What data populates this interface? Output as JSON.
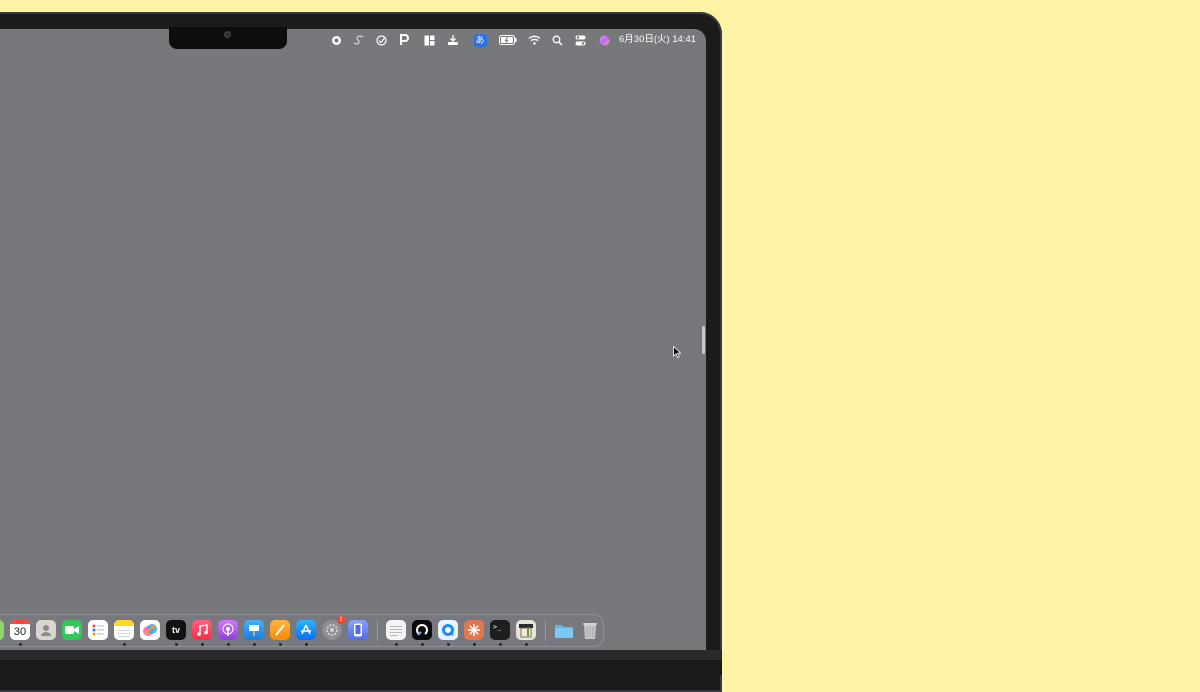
{
  "menubar": {
    "input_method": "あ",
    "datetime": "6月30日(火)  14:41",
    "status_icons": [
      "record-icon",
      "s-icon",
      "checkmark-icon",
      "p-icon",
      "layout-icon",
      "download-icon",
      "input-method-icon",
      "battery-icon",
      "wifi-icon",
      "search-icon",
      "control-center-icon",
      "siri-icon"
    ]
  },
  "dock": {
    "calendar_day": "30",
    "tv_label": "tv",
    "terminal_prompt": ">_",
    "system_settings_badge": "1",
    "icons": [
      "partial-icon",
      "calendar-icon",
      "contacts-icon",
      "facetime-icon",
      "reminders-icon",
      "notes-icon",
      "freeform-icon",
      "apple-tv-icon",
      "music-icon",
      "podcasts-icon",
      "keynote-icon",
      "pages-icon",
      "app-store-icon",
      "system-settings-icon",
      "simulator-icon",
      "textedit-icon",
      "arc-icon",
      "quicktime-icon",
      "claude-icon",
      "terminal-icon",
      "scrivener-icon",
      "downloads-folder-icon",
      "trash-icon"
    ]
  },
  "colors": {
    "background": "#fff3a6",
    "screen": "#77787c",
    "bezel": "#1b1b1d"
  }
}
